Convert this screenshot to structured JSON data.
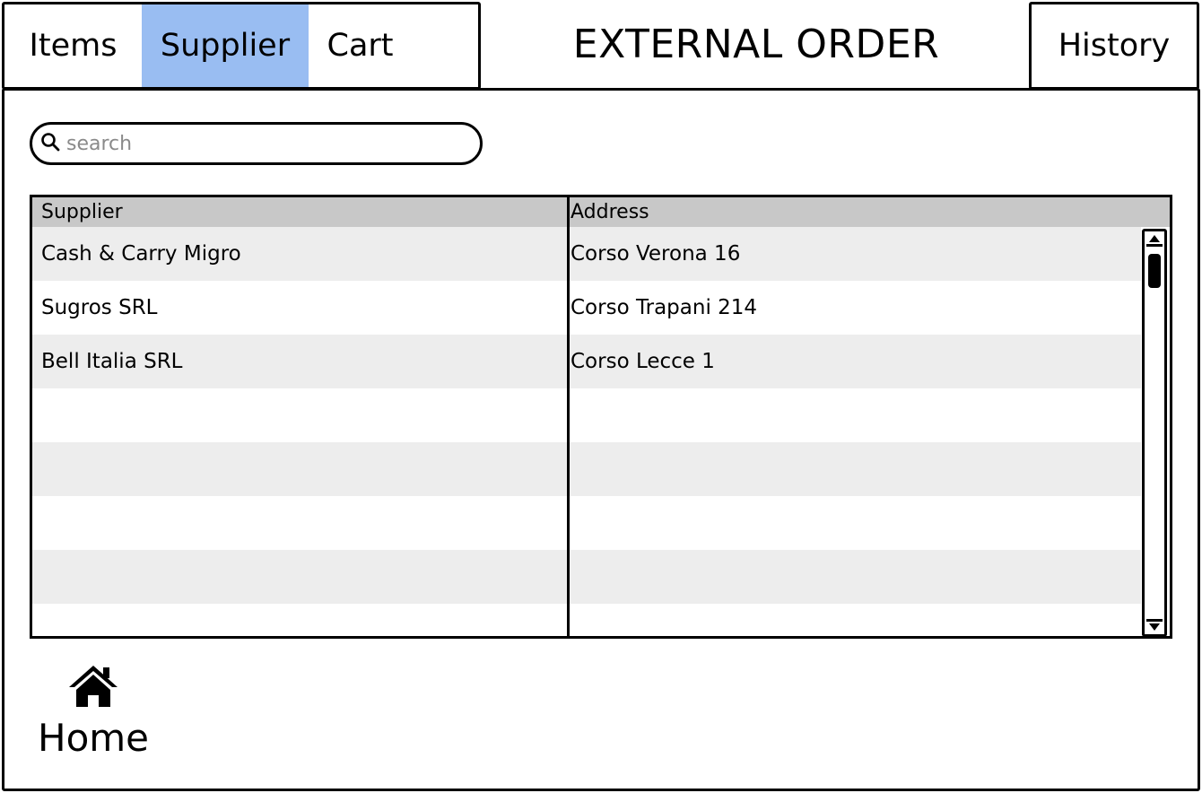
{
  "tabs": {
    "items_label": "Items",
    "supplier_label": "Supplier",
    "cart_label": "Cart",
    "history_label": "History",
    "active": "Supplier",
    "active_color": "#99bdf2"
  },
  "header": {
    "title": "EXTERNAL ORDER"
  },
  "search": {
    "placeholder": "search",
    "value": "",
    "icon": "search-icon"
  },
  "table": {
    "columns": [
      "Supplier",
      "Address"
    ],
    "rows": [
      [
        "Cash & Carry Migro",
        "Corso Verona 16"
      ],
      [
        "Sugros SRL",
        "Corso Trapani 214"
      ],
      [
        "Bell Italia SRL",
        "Corso Lecce 1"
      ],
      [
        "",
        ""
      ],
      [
        "",
        ""
      ],
      [
        "",
        ""
      ],
      [
        "",
        ""
      ],
      [
        "",
        ""
      ]
    ],
    "header_color": "#c8c8c8",
    "stripe_color": "#ededed"
  },
  "home": {
    "label": "Home",
    "icon": "home-icon"
  }
}
